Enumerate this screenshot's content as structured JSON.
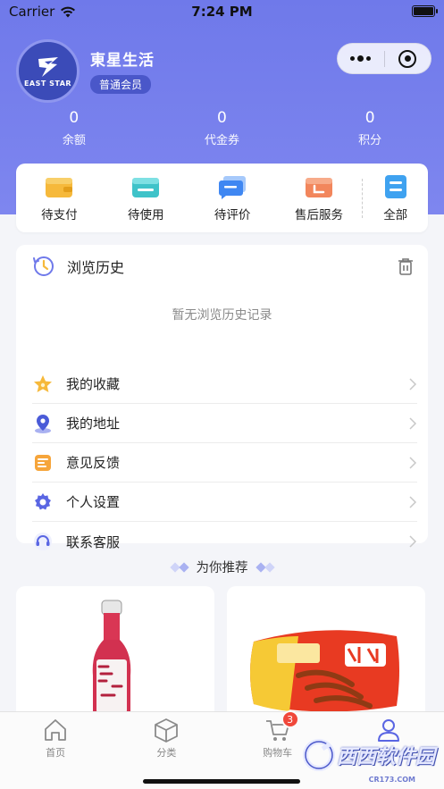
{
  "status_bar": {
    "carrier": "Carrier",
    "time": "7:24 PM"
  },
  "profile": {
    "logo_text": "EAST STAR",
    "name": "東星生活",
    "member_level": "普通会员"
  },
  "stats": [
    {
      "value": "0",
      "label": "余额"
    },
    {
      "value": "0",
      "label": "代金券"
    },
    {
      "value": "0",
      "label": "积分"
    }
  ],
  "orders": {
    "pending_payment": "待支付",
    "to_use": "待使用",
    "to_review": "待评价",
    "after_sales": "售后服务",
    "all": "全部"
  },
  "history": {
    "title": "浏览历史",
    "empty": "暂无浏览历史记录"
  },
  "menu": [
    {
      "label": "我的收藏",
      "icon": "star-icon"
    },
    {
      "label": "我的地址",
      "icon": "location-icon"
    },
    {
      "label": "意见反馈",
      "icon": "feedback-icon"
    },
    {
      "label": "个人设置",
      "icon": "settings-icon"
    },
    {
      "label": "联系客服",
      "icon": "headset-icon"
    }
  ],
  "recommend_title": "为你推荐",
  "tabs": [
    {
      "label": "首页",
      "icon": "home-icon"
    },
    {
      "label": "分类",
      "icon": "category-icon"
    },
    {
      "label": "购物车",
      "icon": "cart-icon",
      "badge": "3"
    },
    {
      "label": "我的",
      "icon": "user-icon"
    }
  ],
  "watermark": {
    "text": "西西软件园",
    "sub": "CR173.COM"
  },
  "colors": {
    "brand": "#6f79ea",
    "badge": "#f0473a",
    "active_tab": "#5a66e3"
  }
}
